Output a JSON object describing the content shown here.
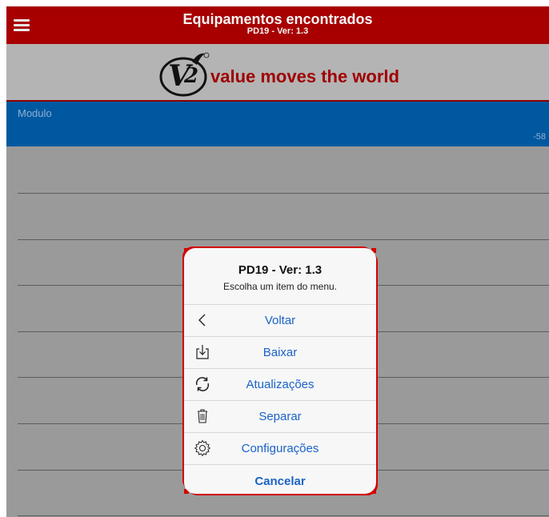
{
  "header": {
    "title": "Equipamentos encontrados",
    "subtitle": "PD19 - Ver: 1.3",
    "menu_icon": "hamburger-icon"
  },
  "brand": {
    "logo_text": "V2",
    "tagline": "value moves the world",
    "color": "#a80000"
  },
  "module": {
    "label": "Modulo",
    "value": "-58",
    "color": "#0059a0"
  },
  "action_sheet": {
    "title": "PD19 - Ver: 1.3",
    "message": "Escolha um item do menu.",
    "items": [
      {
        "label": "Voltar",
        "icon": "chevron-left-icon"
      },
      {
        "label": "Baixar",
        "icon": "download-icon"
      },
      {
        "label": "Atualizações",
        "icon": "refresh-icon"
      },
      {
        "label": "Separar",
        "icon": "trash-icon"
      },
      {
        "label": "Configurações",
        "icon": "gear-icon"
      }
    ],
    "cancel_label": "Cancelar",
    "accent": "#1a63c8"
  }
}
